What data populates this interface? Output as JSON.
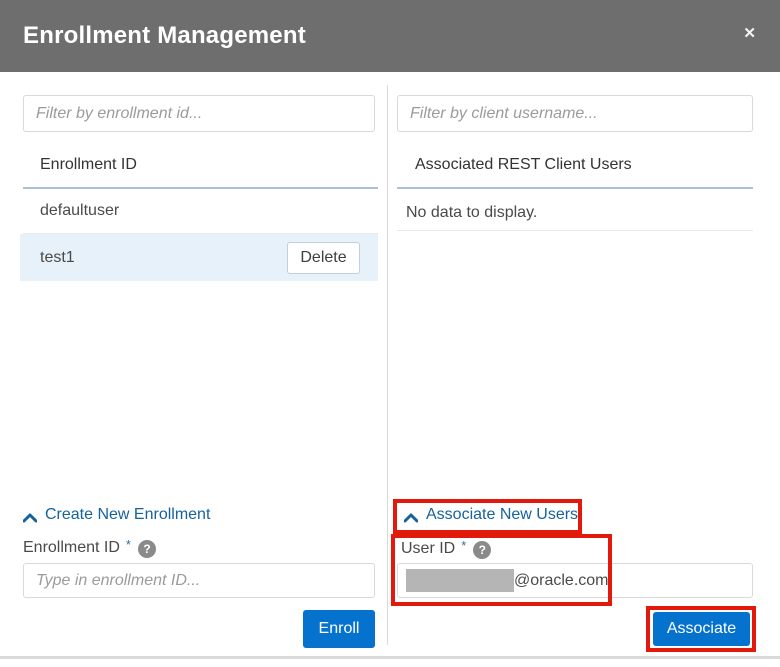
{
  "dialog": {
    "title": "Enrollment Management",
    "close_icon": "✕"
  },
  "left_panel": {
    "filter_placeholder": "Filter by enrollment id...",
    "table_header": "Enrollment ID",
    "rows": [
      {
        "id": "defaultuser",
        "selected": false
      },
      {
        "id": "test1",
        "selected": true,
        "action_label": "Delete"
      }
    ],
    "create_section": {
      "toggle_label": "Create New Enrollment",
      "field_label": "Enrollment ID",
      "required_marker": "*",
      "help_icon": "?",
      "input_placeholder": "Type in enrollment ID...",
      "submit_label": "Enroll"
    }
  },
  "right_panel": {
    "filter_placeholder": "Filter by client username...",
    "table_header": "Associated REST Client Users",
    "empty_message": "No data to display.",
    "associate_section": {
      "toggle_label": "Associate New Users",
      "field_label": "User ID",
      "required_marker": "*",
      "help_icon": "?",
      "input_value_visible": "@oracle.com",
      "submit_label": "Associate"
    }
  },
  "colors": {
    "header_background": "#6e6e6e",
    "primary_button_blue": "#0572ce",
    "link_blue": "#15629e",
    "selected_row_background": "#e7f1f9",
    "table_header_underline": "#a9c2d8",
    "annotation_red": "#e11a0c",
    "redaction_gray": "#b5b5b5"
  }
}
